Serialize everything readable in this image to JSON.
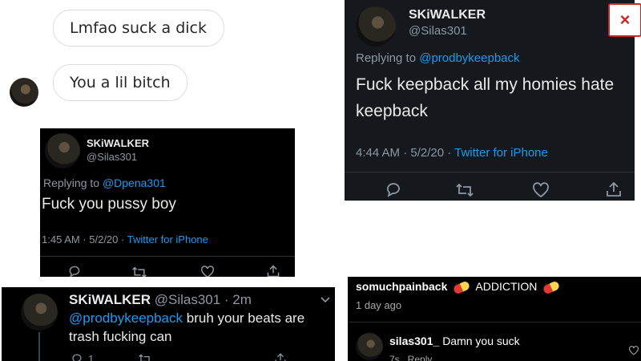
{
  "dm": {
    "bubble1": "Lmfao suck a dick",
    "bubble2": "You a lil bitch"
  },
  "tweet_top_right": {
    "name": "SKiWALKER",
    "handle": "@Silas301",
    "replying_prefix": "Replying to",
    "replying_to": "@prodbykeepback",
    "text_line1": "Fuck keepback all my homies hate",
    "text_line2": "keepback",
    "time": "4:44 AM · 5/2/20 ·",
    "source": "Twitter for iPhone"
  },
  "tweet_middle": {
    "name": "SKiWALKER",
    "handle": "@Silas301",
    "replying_prefix": "Replying to",
    "replying_to": "@Dpena301",
    "text": "Fuck you pussy boy",
    "time": "1:45 AM · 5/2/20 ·",
    "source": "Twitter for iPhone"
  },
  "tweet_bottom": {
    "name": "SKiWALKER",
    "handle": "@Silas301 · 2m",
    "mention": "@prodbykeepback",
    "text_rest": "bruh your beats are",
    "text_line2": "trash fucking can",
    "reply_count": "1"
  },
  "ig_comment": {
    "username": "somuchpainback",
    "tag": "ADDICTION",
    "age": "1 day ago",
    "commenter": "silas301_",
    "comment": "Damn you suck",
    "reply_meta": "7s   Reply"
  },
  "close_label": "×",
  "colors": {
    "accent_link": "#1d9bf0",
    "panel_bg": "#15181c",
    "close_red": "#c62828"
  },
  "icons": [
    "reply-icon",
    "retweet-icon",
    "like-icon",
    "share-icon",
    "close-icon",
    "pill-icon",
    "chevron-down-icon"
  ]
}
